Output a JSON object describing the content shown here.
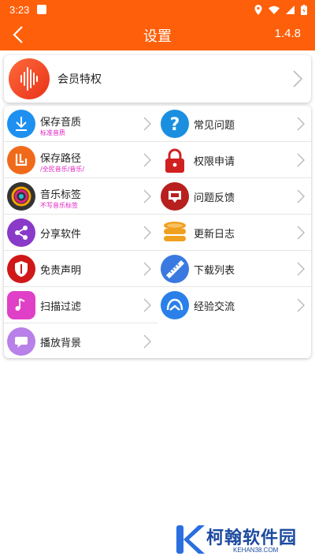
{
  "status_bar": {
    "time": "3:23"
  },
  "app_bar": {
    "title": "设置",
    "version": "1.4.8"
  },
  "vip": {
    "label": "会员特权"
  },
  "left_items": [
    {
      "label": "保存音质",
      "sub": "标准音质",
      "icon": "download-icon",
      "color": "#1e90f0"
    },
    {
      "label": "保存路径",
      "sub": "/全民音乐/音乐/",
      "icon": "folder-path-icon",
      "color": "#f06a1a"
    },
    {
      "label": "音乐标签",
      "sub": "不写音乐标签",
      "icon": "music-tag-icon",
      "color": "#333333"
    },
    {
      "label": "分享软件",
      "sub": "",
      "icon": "share-icon",
      "color": "#8a3ac8"
    },
    {
      "label": "免责声明",
      "sub": "",
      "icon": "shield-icon",
      "color": "#d01818"
    },
    {
      "label": "扫描过滤",
      "sub": "",
      "icon": "scan-music-icon",
      "color": "#e040c8"
    },
    {
      "label": "播放背景",
      "sub": "",
      "icon": "chat-bubble-icon",
      "color": "#b880e8"
    }
  ],
  "right_items": [
    {
      "label": "常见问题",
      "icon": "question-icon",
      "color": "#1a8fe0"
    },
    {
      "label": "权限申请",
      "icon": "lock-icon",
      "color": "#d02020"
    },
    {
      "label": "问题反馈",
      "icon": "feedback-icon",
      "color": "#b82020"
    },
    {
      "label": "更新日志",
      "icon": "database-icon",
      "color": "#f0a020"
    },
    {
      "label": "下载列表",
      "icon": "ruler-list-icon",
      "color": "#3a7ae0"
    },
    {
      "label": "经验交流",
      "icon": "community-icon",
      "color": "#2a80e8"
    }
  ],
  "watermark": {
    "name": "柯翰软件园",
    "url": "KEHAN38.COM"
  }
}
